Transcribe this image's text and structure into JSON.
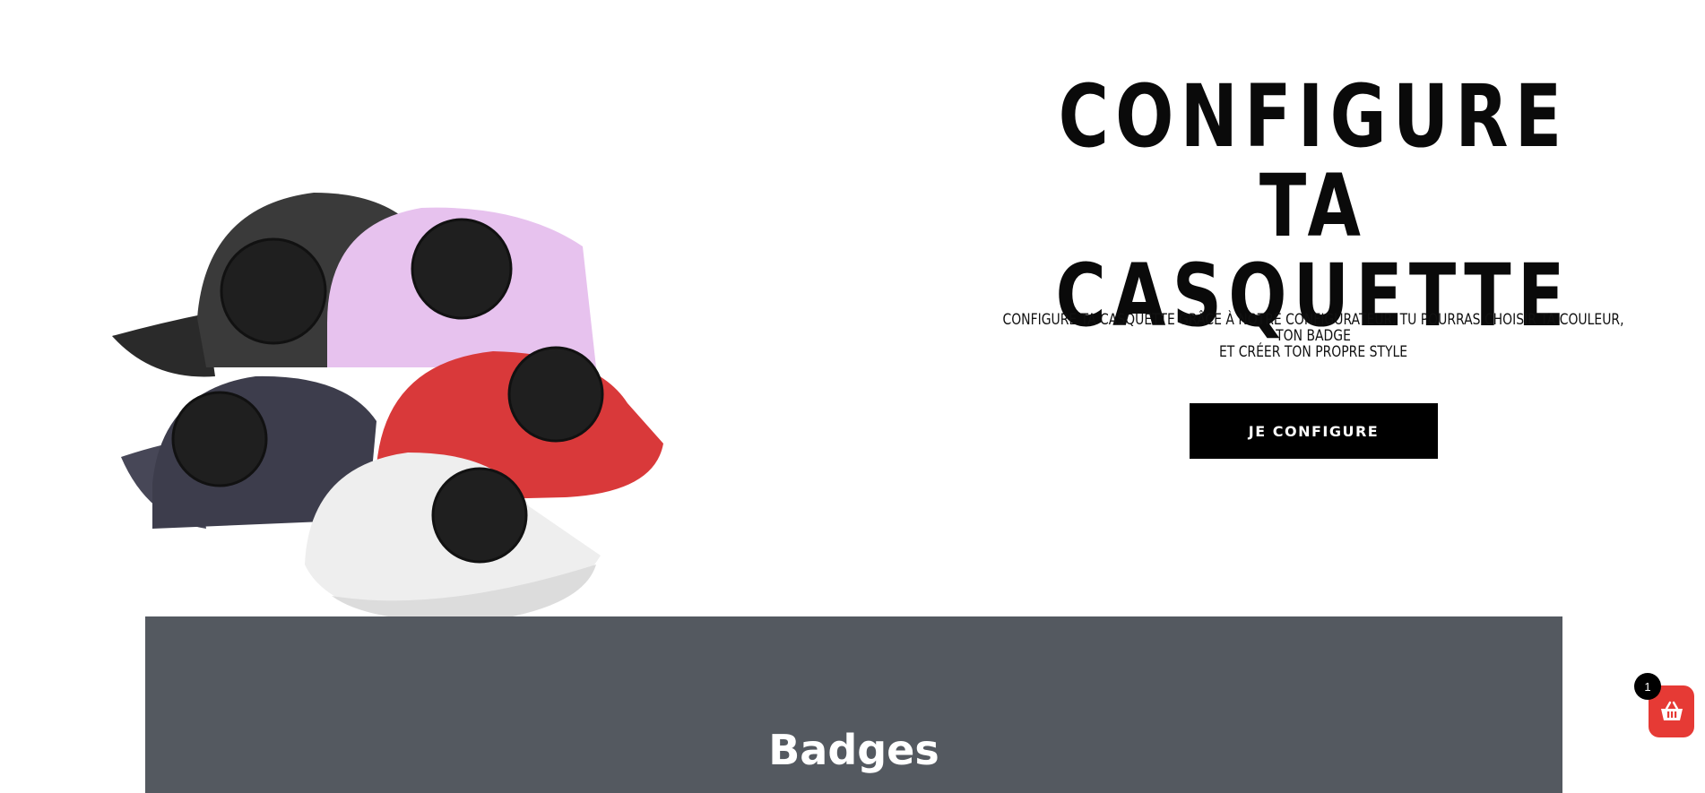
{
  "hero": {
    "title_line1": "CONFIGURE TA",
    "title_line2": "CASQUETTE",
    "subtitle_line1": "CONFIGURE TA CASQUETTE GRÂCE À NOTRE CONFIGURATEUR. TU POURRAS CHOISIR TA COULEUR, TON BADGE",
    "subtitle_line2": "ET CRÉER TON PROPRE STYLE",
    "cta_label": "JE CONFIGURE"
  },
  "section": {
    "title": "Badges"
  },
  "cart": {
    "count": "1",
    "icon": "basket-icon"
  },
  "colors": {
    "cta_bg": "#000000",
    "band_bg": "#545960",
    "cart_bg": "#e63a35",
    "caps": [
      "#3a3a3a",
      "#e7c2ee",
      "#d9393a",
      "#3d3d4c",
      "#eeeeee"
    ]
  }
}
